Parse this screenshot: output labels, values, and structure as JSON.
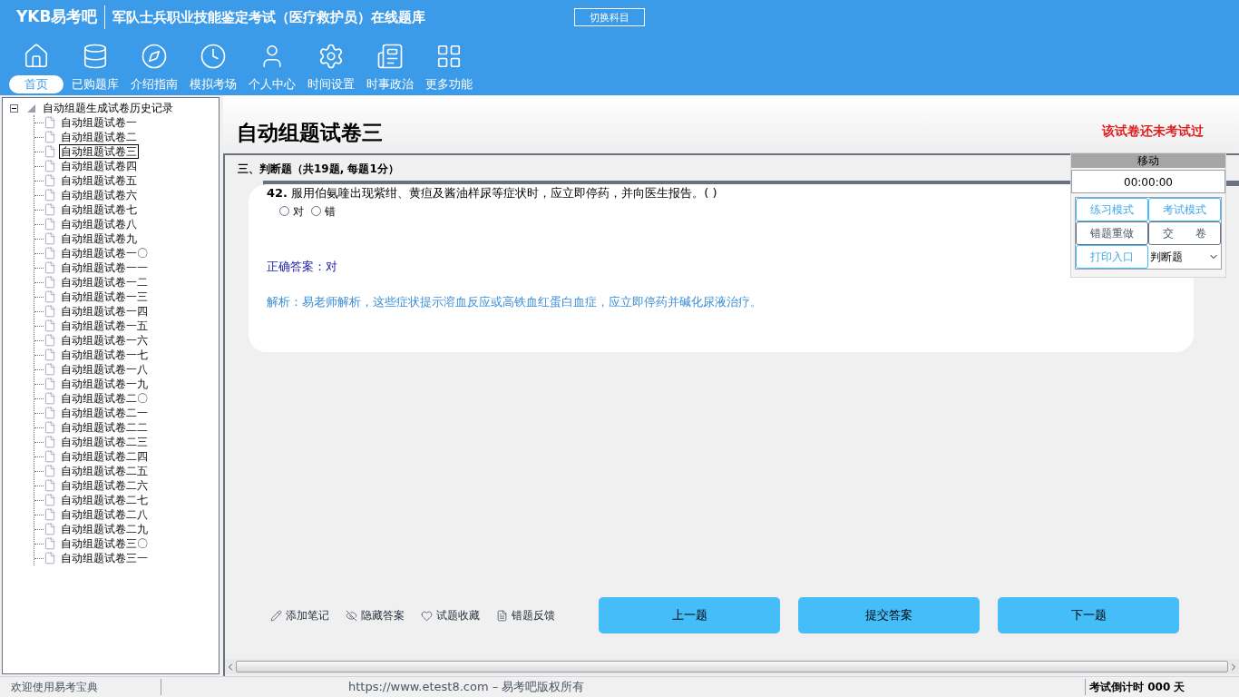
{
  "header": {
    "logo": "YKB易考吧",
    "title": "军队士兵职业技能鉴定考试（医疗救护员）在线题库",
    "switch_button": "切换科目"
  },
  "nav": [
    {
      "label": "首页",
      "selected": true
    },
    {
      "label": "已购题库",
      "selected": false
    },
    {
      "label": "介绍指南",
      "selected": false
    },
    {
      "label": "模拟考场",
      "selected": false
    },
    {
      "label": "个人中心",
      "selected": false
    },
    {
      "label": "时间设置",
      "selected": false
    },
    {
      "label": "时事政治",
      "selected": false
    },
    {
      "label": "更多功能",
      "selected": false
    }
  ],
  "tree": {
    "root": "自动组题生成试卷历史记录",
    "expanded": true,
    "children": [
      {
        "label": "自动组题试卷一",
        "selected": false
      },
      {
        "label": "自动组题试卷二",
        "selected": false
      },
      {
        "label": "自动组题试卷三",
        "selected": true
      },
      {
        "label": "自动组题试卷四",
        "selected": false
      },
      {
        "label": "自动组题试卷五",
        "selected": false
      },
      {
        "label": "自动组题试卷六",
        "selected": false
      },
      {
        "label": "自动组题试卷七",
        "selected": false
      },
      {
        "label": "自动组题试卷八",
        "selected": false
      },
      {
        "label": "自动组题试卷九",
        "selected": false
      },
      {
        "label": "自动组题试卷一〇",
        "selected": false
      },
      {
        "label": "自动组题试卷一一",
        "selected": false
      },
      {
        "label": "自动组题试卷一二",
        "selected": false
      },
      {
        "label": "自动组题试卷一三",
        "selected": false
      },
      {
        "label": "自动组题试卷一四",
        "selected": false
      },
      {
        "label": "自动组题试卷一五",
        "selected": false
      },
      {
        "label": "自动组题试卷一六",
        "selected": false
      },
      {
        "label": "自动组题试卷一七",
        "selected": false
      },
      {
        "label": "自动组题试卷一八",
        "selected": false
      },
      {
        "label": "自动组题试卷一九",
        "selected": false
      },
      {
        "label": "自动组题试卷二〇",
        "selected": false
      },
      {
        "label": "自动组题试卷二一",
        "selected": false
      },
      {
        "label": "自动组题试卷二二",
        "selected": false
      },
      {
        "label": "自动组题试卷二三",
        "selected": false
      },
      {
        "label": "自动组题试卷二四",
        "selected": false
      },
      {
        "label": "自动组题试卷二五",
        "selected": false
      },
      {
        "label": "自动组题试卷二六",
        "selected": false
      },
      {
        "label": "自动组题试卷二七",
        "selected": false
      },
      {
        "label": "自动组题试卷二八",
        "selected": false
      },
      {
        "label": "自动组题试卷二九",
        "selected": false
      },
      {
        "label": "自动组题试卷三〇",
        "selected": false
      },
      {
        "label": "自动组题试卷三一",
        "selected": false
      }
    ]
  },
  "paper": {
    "title": "自动组题试卷三",
    "status": "该试卷还未考试过"
  },
  "section": "三、判断题（共19题, 每题1分）",
  "question": {
    "number": "42.",
    "text": "服用伯氨喹出现紫绀、黄疸及酱油样尿等症状时，应立即停药，并向医生报告。( )",
    "options": [
      {
        "label": "对",
        "selected": false
      },
      {
        "label": "错",
        "selected": false
      }
    ],
    "answer": "正确答案：对",
    "explanation": "解析：易老师解析，这些症状提示溶血反应或高铁血红蛋白血症，应立即停药并碱化尿液治疗。"
  },
  "tool_panel": {
    "title": "移动",
    "timer": "00:00:00",
    "buttons": [
      {
        "label": "练习模式",
        "kind": "accent"
      },
      {
        "label": "考试模式",
        "kind": "accent"
      },
      {
        "label": "错题重做",
        "kind": "plain"
      },
      {
        "label": "交　　卷",
        "kind": "plain"
      },
      {
        "label": "打印入口",
        "kind": "accent"
      }
    ],
    "select": "判断题"
  },
  "actions": [
    "添加笔记",
    "隐藏答案",
    "试题收藏",
    "错题反馈"
  ],
  "nav_buttons": [
    "上一题",
    "提交答案",
    "下一题"
  ],
  "status_bar": {
    "welcome": "欢迎使用易考宝典",
    "copyright": "https://www.etest8.com – 易考吧版权所有",
    "countdown": "考试倒计时 000 天"
  }
}
